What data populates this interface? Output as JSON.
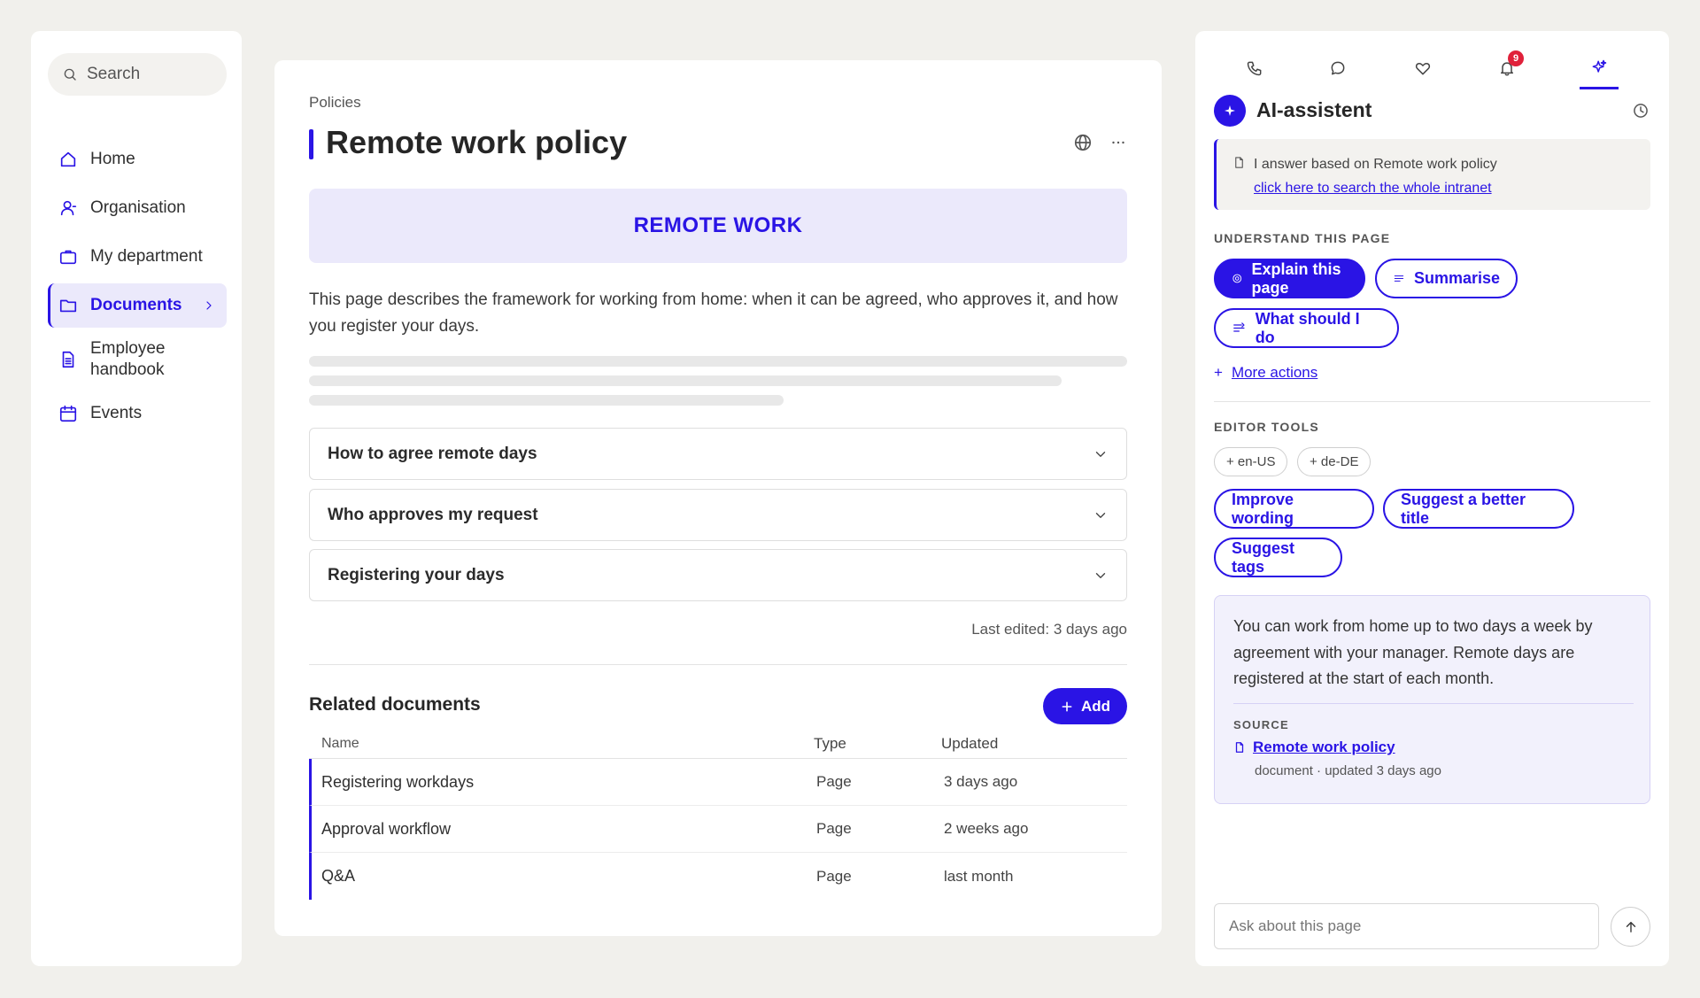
{
  "colors": {
    "accent": "#2a14e5",
    "accent_soft": "#ebe9fb",
    "page_bg": "#f1f0ec",
    "badge": "#e0213a"
  },
  "nav": {
    "search_placeholder": "Search",
    "items": [
      {
        "label": "Home",
        "icon": "home-icon"
      },
      {
        "label": "Organisation",
        "icon": "user-icon"
      },
      {
        "label": "My department",
        "icon": "briefcase-icon"
      },
      {
        "label": "Documents",
        "icon": "folder-icon",
        "active": true
      },
      {
        "label": "Employee handbook",
        "icon": "document-icon"
      },
      {
        "label": "Events",
        "icon": "calendar-icon"
      }
    ]
  },
  "page": {
    "breadcrumb": "Policies",
    "title": "Remote work policy",
    "banner": "REMOTE WORK",
    "description": "This page describes the framework for working from home: when it can be agreed, who approves it, and how you register your days.",
    "sections": [
      "How to agree remote days",
      "Who approves my request",
      "Registering your days"
    ],
    "last_edited": "Last edited: 3 days ago"
  },
  "related": {
    "title": "Related documents",
    "add_label": "Add",
    "columns": [
      "Name",
      "Type",
      "Updated"
    ],
    "rows": [
      {
        "name": "Registering workdays",
        "type": "Page",
        "updated": "3 days ago"
      },
      {
        "name": "Approval workflow",
        "type": "Page",
        "updated": "2 weeks ago"
      },
      {
        "name": "Q&A",
        "type": "Page",
        "updated": "last month"
      }
    ]
  },
  "panel": {
    "tabs": [
      "phone-icon",
      "chat-icon",
      "heart-icon",
      "bell-icon",
      "sparkle-icon"
    ],
    "notification_count": "9",
    "title": "AI-assistent",
    "info_text": "I answer based on Remote work policy",
    "info_link": "click here to search the whole intranet",
    "understand_label": "UNDERSTAND THIS PAGE",
    "actions": {
      "explain": "Explain this page",
      "summarise": "Summarise",
      "what_to_do": "What should I do"
    },
    "more_actions": "More actions",
    "editor_label": "EDITOR TOOLS",
    "languages": [
      "+ en-US",
      "+ de-DE"
    ],
    "editor_actions": {
      "improve": "Improve wording",
      "title": "Suggest a better title",
      "tags": "Suggest tags"
    },
    "answer": {
      "text": "You can work from home up to two days a week by agreement with your manager. Remote days are registered at the start of each month.",
      "source_label": "SOURCE",
      "source_title": "Remote work policy",
      "source_meta": "document · updated 3 days ago"
    },
    "ask_placeholder": "Ask about this page"
  }
}
